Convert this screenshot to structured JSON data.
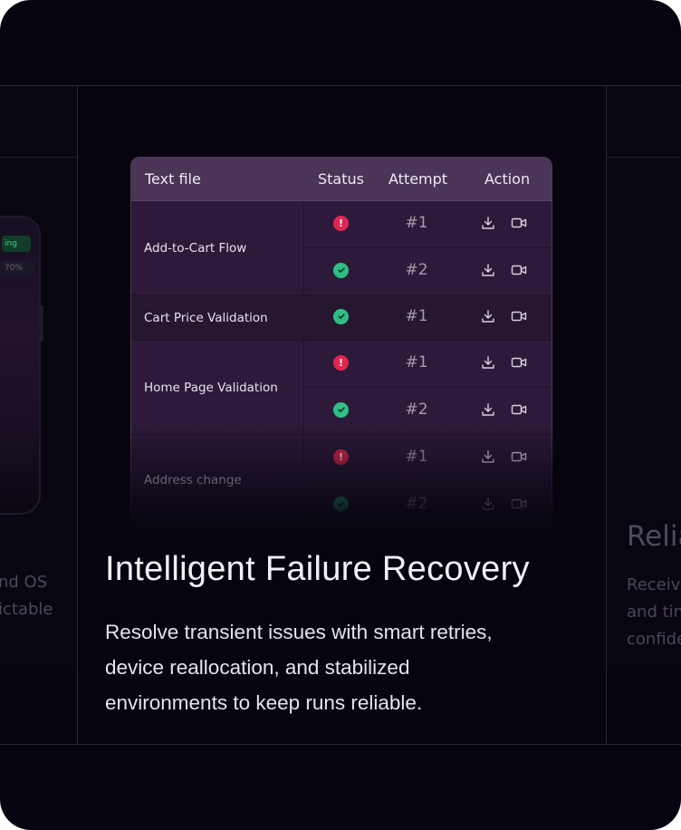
{
  "left_panel": {
    "badge_text": "ing",
    "percent_text": "70%",
    "line_1": "nd OS",
    "line_2": "ictable"
  },
  "right_panel": {
    "title": "Relia",
    "line_1": "Receiv",
    "line_2": "and tin",
    "line_3": "confide"
  },
  "table": {
    "headers": {
      "name": "Text file",
      "status": "Status",
      "attempt": "Attempt",
      "action": "Action"
    },
    "groups": [
      {
        "name": "Add-to-Cart Flow",
        "attempts": [
          {
            "status": "fail",
            "label": "#1"
          },
          {
            "status": "pass",
            "label": "#2"
          }
        ]
      },
      {
        "name": "Cart Price Validation",
        "attempts": [
          {
            "status": "pass",
            "label": "#1"
          }
        ]
      },
      {
        "name": "Home Page Validation",
        "attempts": [
          {
            "status": "fail",
            "label": "#1"
          },
          {
            "status": "pass",
            "label": "#2"
          }
        ]
      },
      {
        "name": "Address change",
        "attempts": [
          {
            "status": "fail",
            "label": "#1"
          },
          {
            "status": "pass",
            "label": "#2"
          }
        ]
      }
    ]
  },
  "feature": {
    "title": "Intelligent Failure Recovery",
    "body_line_1": "Resolve transient issues with smart retries,",
    "body_line_2": "device reallocation, and stabilized",
    "body_line_3": "environments to keep runs reliable."
  },
  "icons": {
    "fail": "exclamation-icon",
    "pass": "check-icon",
    "download": "download-icon",
    "video": "video-camera-icon"
  },
  "colors": {
    "background": "#07040f",
    "card_header": "#4a3557",
    "card_body": "#2d1a3a",
    "fail": "#e0264f",
    "pass": "#2fbf86"
  }
}
